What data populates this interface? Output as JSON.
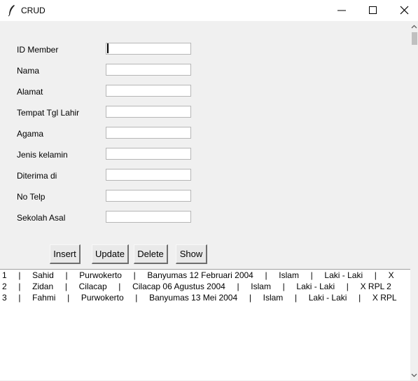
{
  "window": {
    "title": "CRUD",
    "icon": "feather-icon",
    "controls": [
      "minimize-icon",
      "maximize-icon",
      "close-icon"
    ]
  },
  "form": {
    "fields": [
      {
        "label": "ID Member",
        "value": ""
      },
      {
        "label": "Nama",
        "value": ""
      },
      {
        "label": "Alamat",
        "value": ""
      },
      {
        "label": "Tempat Tgl Lahir",
        "value": ""
      },
      {
        "label": "Agama",
        "value": ""
      },
      {
        "label": "Jenis kelamin",
        "value": ""
      },
      {
        "label": "Diterima di",
        "value": ""
      },
      {
        "label": "No Telp",
        "value": ""
      },
      {
        "label": "Sekolah Asal",
        "value": ""
      }
    ]
  },
  "buttons": {
    "insert": "Insert",
    "update": "Update",
    "delete": "Delete",
    "show": "Show"
  },
  "listbox": {
    "rows": [
      "1     |     Sahid     |     Purwokerto     |     Banyumas 12 Februari 2004     |     Islam     |     Laki - Laki     |     X",
      "2     |     Zidan     |     Cilacap     |     Cilacap 06 Agustus 2004     |     Islam     |     Laki - Laki     |     X RPL 2",
      "3     |     Fahmi     |     Purwokerto     |     Banyumas 13 Mei 2004     |     Islam     |     Laki - Laki     |     X RPL"
    ]
  },
  "colors": {
    "window_bg": "#f0f0f0",
    "titlebar_bg": "#ffffff",
    "field_bg": "#ffffff",
    "button_bg": "#e9e9e9"
  }
}
